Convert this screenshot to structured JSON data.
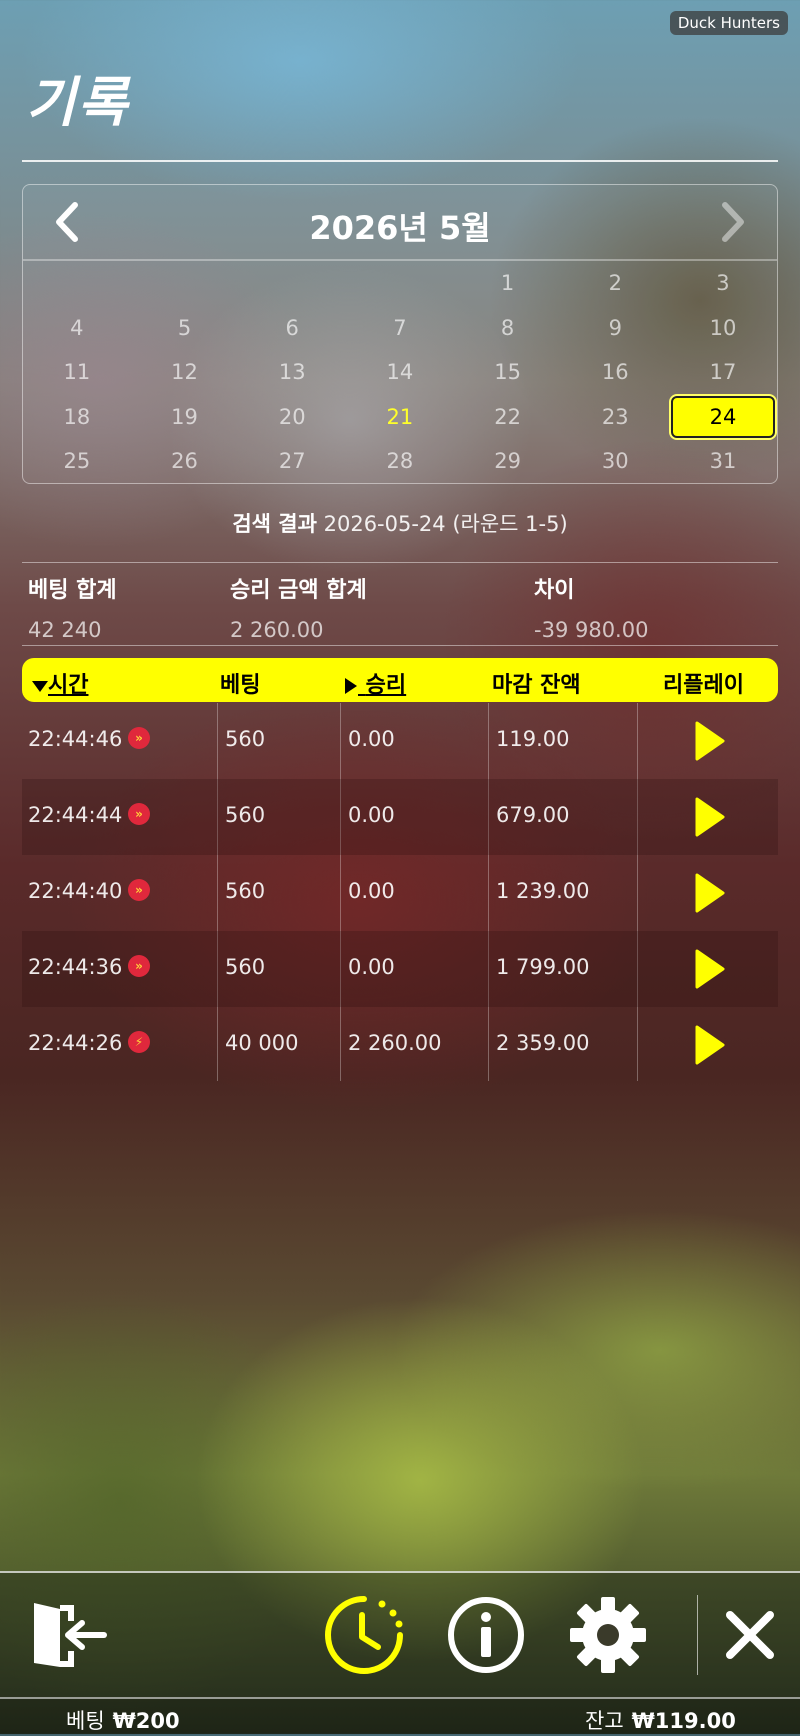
{
  "brand": "Duck Hunters",
  "page_title": "기록",
  "calendar": {
    "title": "2026년 5월",
    "weeks": [
      [
        "",
        "",
        "",
        "",
        "1",
        "2",
        "3"
      ],
      [
        "4",
        "5",
        "6",
        "7",
        "8",
        "9",
        "10"
      ],
      [
        "11",
        "12",
        "13",
        "14",
        "15",
        "16",
        "17"
      ],
      [
        "18",
        "19",
        "20",
        "21",
        "22",
        "23",
        "24"
      ],
      [
        "25",
        "26",
        "27",
        "28",
        "29",
        "30",
        "31"
      ]
    ],
    "today": "21",
    "selected": "24"
  },
  "search": {
    "label": "검색 결과",
    "value": "2026-05-24 (라운드 1-5)"
  },
  "summary": {
    "bet_total_label": "베팅 합계",
    "bet_total_value": "42 240",
    "win_total_label": "승리 금액 합계",
    "win_total_value": "2 260.00",
    "diff_label": "차이",
    "diff_value": "-39 980.00"
  },
  "table": {
    "headers": {
      "time": "시간",
      "bet": "베팅",
      "win": "승리",
      "balance": "마감 잔액",
      "replay": "리플레이"
    },
    "rows": [
      {
        "time": "22:44:46",
        "mode": "fast-forward",
        "bet": "560",
        "win": "0.00",
        "balance": "119.00"
      },
      {
        "time": "22:44:44",
        "mode": "fast-forward",
        "bet": "560",
        "win": "0.00",
        "balance": "679.00"
      },
      {
        "time": "22:44:40",
        "mode": "fast-forward",
        "bet": "560",
        "win": "0.00",
        "balance": "1 239.00"
      },
      {
        "time": "22:44:36",
        "mode": "fast-forward",
        "bet": "560",
        "win": "0.00",
        "balance": "1 799.00"
      },
      {
        "time": "22:44:26",
        "mode": "lightning",
        "bet": "40 000",
        "win": "2 260.00",
        "balance": "2 359.00"
      }
    ]
  },
  "status": {
    "bet_label": "베팅",
    "bet_value": "₩200",
    "balance_label": "잔고",
    "balance_value": "₩119.00"
  },
  "colors": {
    "accent": "#ffff00",
    "badge": "#e0283c"
  }
}
